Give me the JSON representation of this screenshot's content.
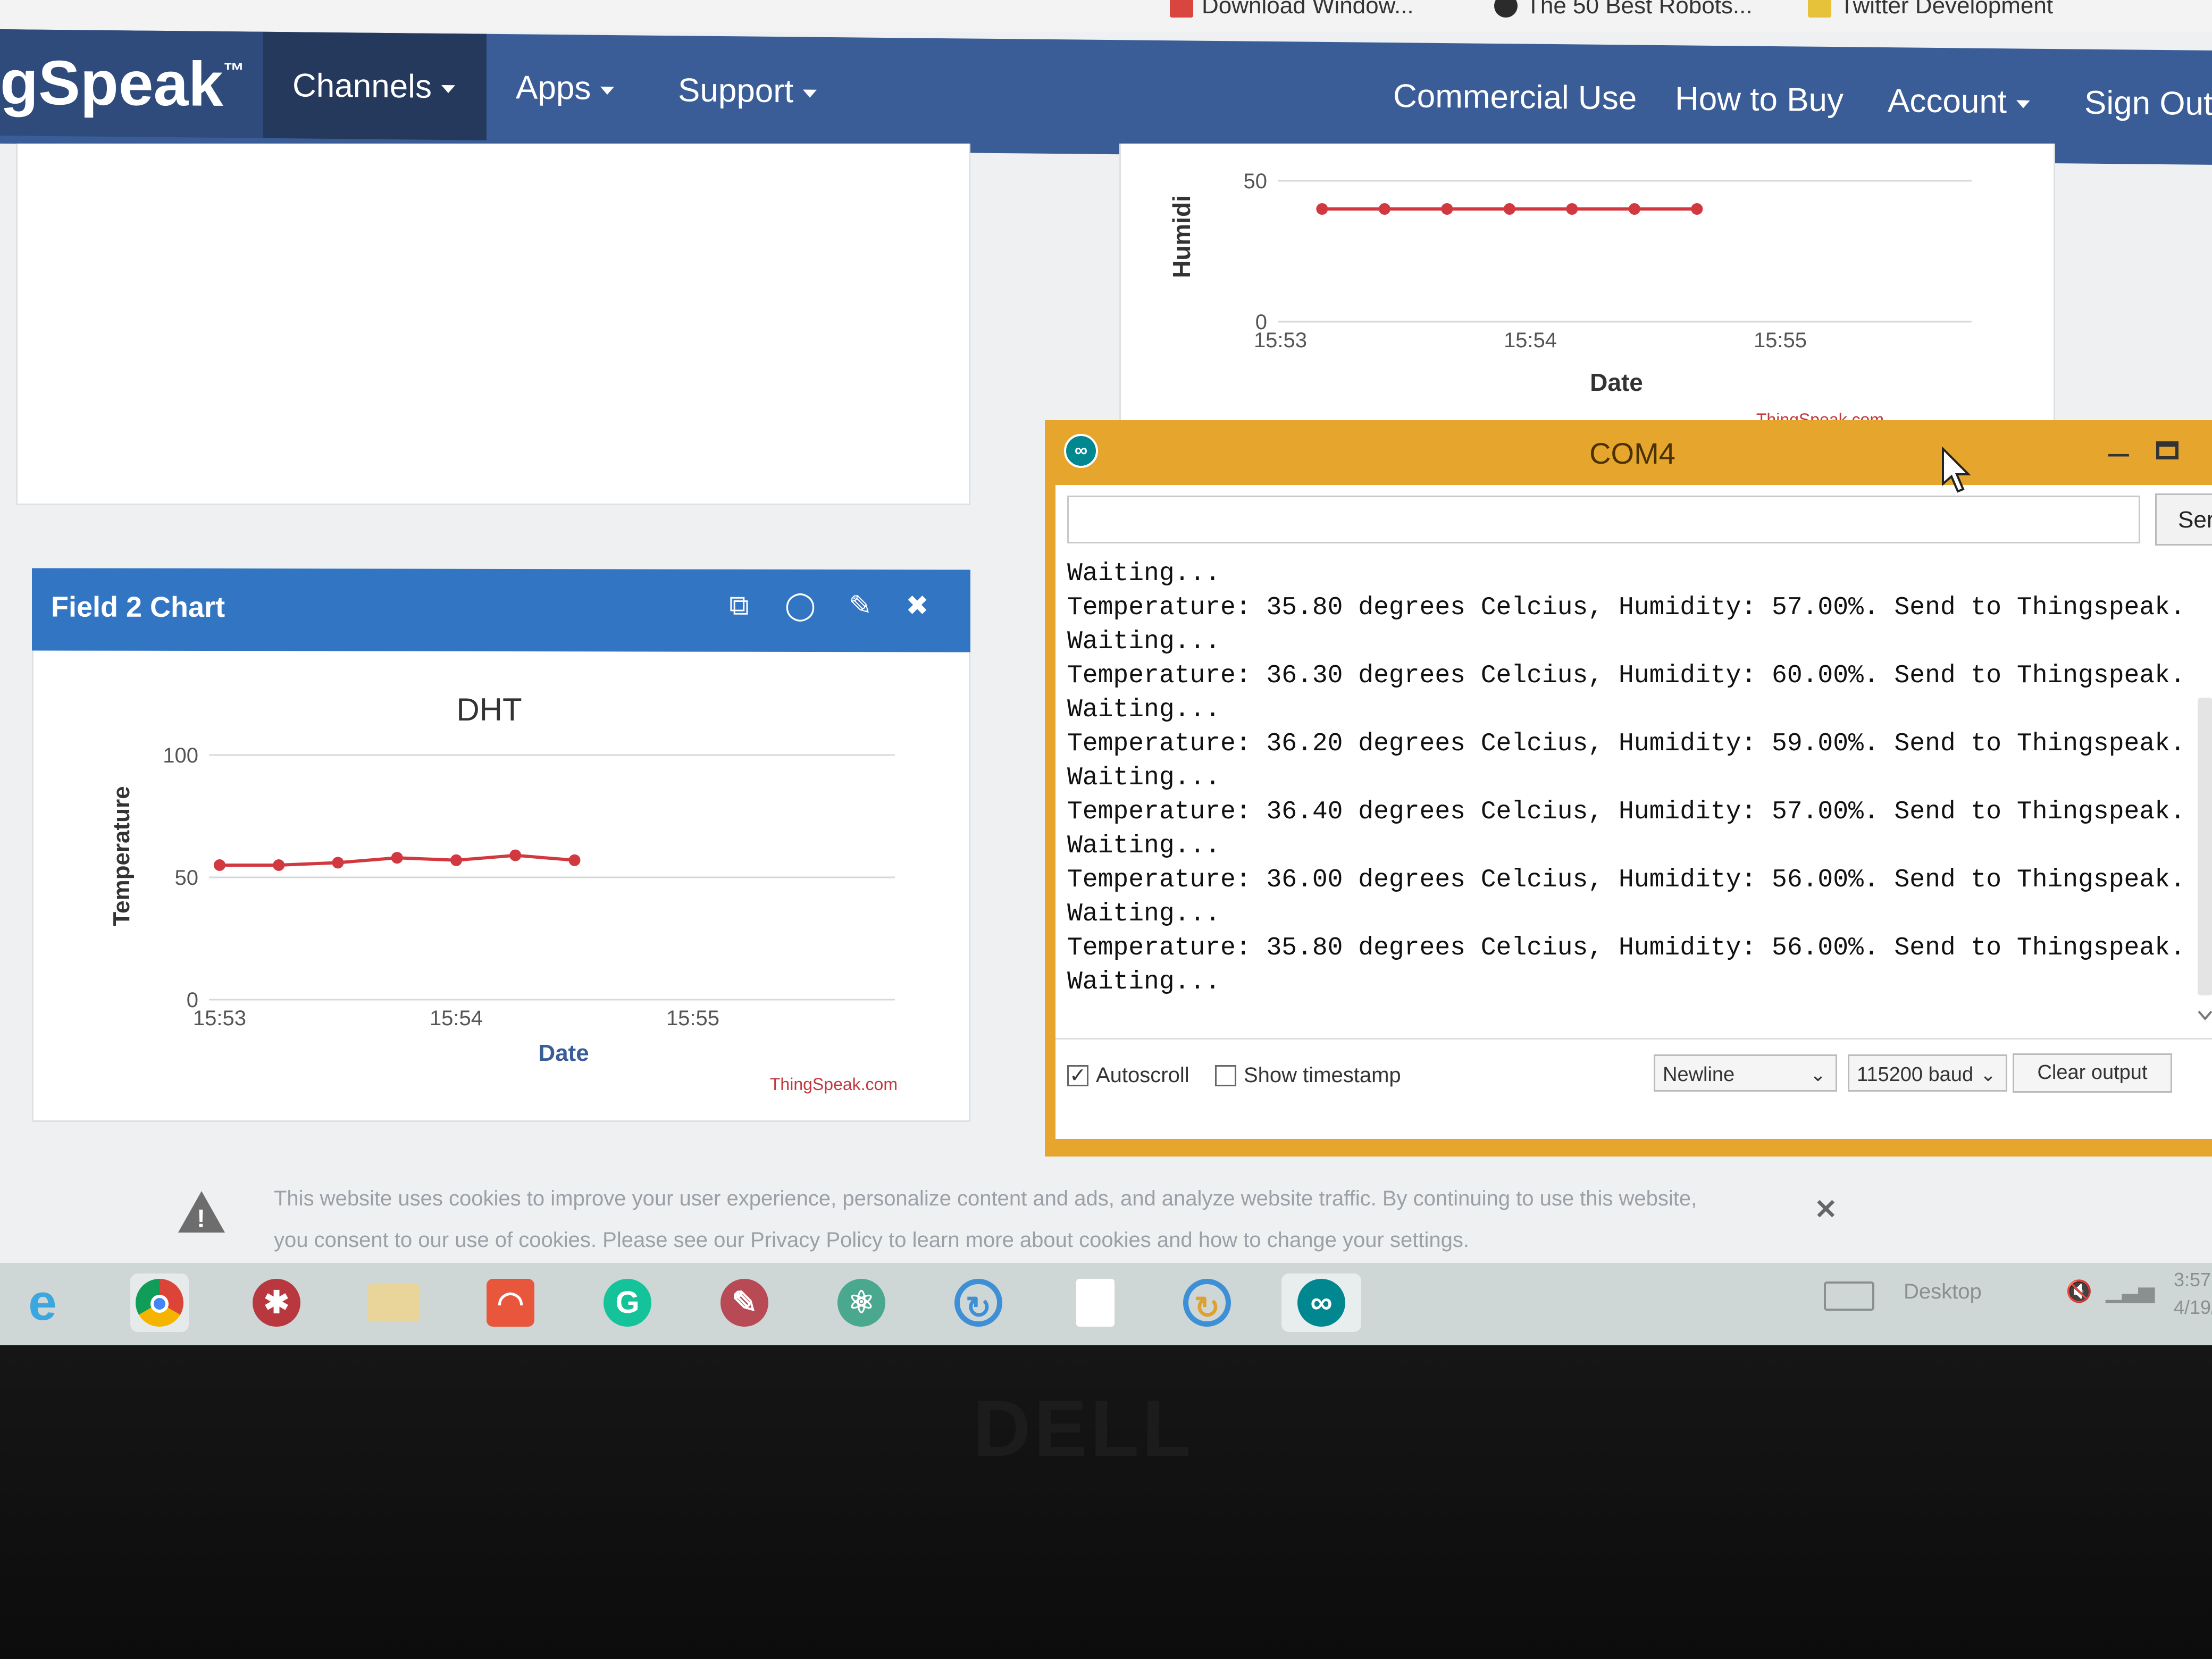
{
  "bookmarks": [
    {
      "label": "Download Window...",
      "icon_color": "#d9463f"
    },
    {
      "label": "The 50 Best Robots...",
      "icon_color": "#2b2b2b"
    },
    {
      "label": "Twitter Development",
      "icon_color": "#e6c23a"
    }
  ],
  "navbar": {
    "brand": "gSpeak",
    "brand_tm": "™",
    "channels": "Channels",
    "apps": "Apps",
    "support": "Support",
    "commercial_use": "Commercial Use",
    "how_to_buy": "How to Buy",
    "account": "Account",
    "sign_out": "Sign Out"
  },
  "humidity_chart": {
    "ylabel": "Humidi",
    "xlabel": "Date",
    "credit": "ThingSpeak.com",
    "chart_data": {
      "type": "line",
      "x": [
        "15:53:10",
        "15:53:25",
        "15:53:40",
        "15:53:55",
        "15:54:10",
        "15:54:25",
        "15:54:40"
      ],
      "xticks": [
        "15:53",
        "15:54",
        "15:55"
      ],
      "yticks": [
        "0",
        "50"
      ],
      "series": [
        {
          "values": [
            40,
            40,
            40,
            40,
            40,
            40,
            40
          ]
        }
      ],
      "xlabel": "Date",
      "ylabel": "Humidi",
      "ylim": [
        0,
        50
      ],
      "color": "#d2383f"
    }
  },
  "field2": {
    "title": "Field 2 Chart",
    "icons": [
      "popout-icon",
      "comment-icon",
      "edit-icon",
      "close-icon"
    ]
  },
  "dht_chart": {
    "title": "DHT",
    "ylabel": "Temperature",
    "xlabel": "Date",
    "credit": "ThingSpeak.com",
    "chart_data": {
      "type": "line",
      "title": "DHT",
      "x": [
        "15:53:00",
        "15:53:15",
        "15:53:30",
        "15:53:45",
        "15:54:00",
        "15:54:15",
        "15:54:30"
      ],
      "xticks": [
        "15:53",
        "15:54",
        "15:55"
      ],
      "yticks": [
        "0",
        "50",
        "100"
      ],
      "series": [
        {
          "values": [
            55,
            55,
            56,
            58,
            57,
            59,
            57
          ]
        }
      ],
      "xlabel": "Date",
      "ylabel": "Temperature",
      "ylim": [
        0,
        100
      ],
      "color": "#d2383f"
    }
  },
  "serial_monitor": {
    "title": "COM4",
    "send_label": "Ser",
    "input_value": "",
    "lines": [
      "Waiting...",
      "Temperature: 35.80 degrees Celcius, Humidity: 57.00%. Send to Thingspeak.",
      "Waiting...",
      "Temperature: 36.30 degrees Celcius, Humidity: 60.00%. Send to Thingspeak.",
      "Waiting...",
      "Temperature: 36.20 degrees Celcius, Humidity: 59.00%. Send to Thingspeak.",
      "Waiting...",
      "Temperature: 36.40 degrees Celcius, Humidity: 57.00%. Send to Thingspeak.",
      "Waiting...",
      "Temperature: 36.00 degrees Celcius, Humidity: 56.00%. Send to Thingspeak.",
      "Waiting...",
      "Temperature: 35.80 degrees Celcius, Humidity: 56.00%. Send to Thingspeak.",
      "Waiting..."
    ],
    "autoscroll_label": "Autoscroll",
    "autoscroll_checked": true,
    "timestamp_label": "Show timestamp",
    "timestamp_checked": false,
    "line_ending": "Newline",
    "baud": "115200 baud",
    "clear_label": "Clear output"
  },
  "cookie_banner": {
    "line1": "This website uses cookies to improve your user experience, personalize content and ads, and analyze website traffic. By continuing to use this website,",
    "line2": "you consent to our use of cookies. Please see our Privacy Policy to learn more about cookies and how to change your settings."
  },
  "taskbar": {
    "apps": [
      "ie-icon",
      "chrome-icon",
      "app-icon",
      "file-explorer-icon",
      "headphones-icon",
      "grammarly-icon",
      "paint-icon",
      "atom-icon",
      "sync-icon",
      "document-icon",
      "sync2-icon",
      "arduino-icon"
    ],
    "desktop_label": "Desktop",
    "time": "3:57",
    "date": "4/19/"
  },
  "monitor": {
    "brand": "DELL"
  }
}
